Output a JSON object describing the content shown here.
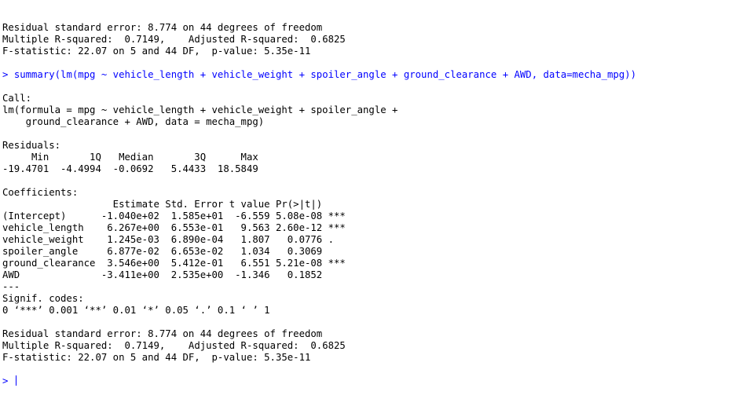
{
  "colors": {
    "command": "#0000ff",
    "output": "#000000",
    "background": "#ffffff"
  },
  "prev_output": [
    "Residual standard error: 8.774 on 44 degrees of freedom",
    "Multiple R-squared:  0.7149,\tAdjusted R-squared:  0.6825 ",
    "F-statistic: 22.07 on 5 and 44 DF,  p-value: 5.35e-11"
  ],
  "command": {
    "prompt": ">",
    "text": "summary(lm(mpg ~ vehicle_length + vehicle_weight + spoiler_angle + ground_clearance + AWD, data=mecha_mpg))"
  },
  "call": {
    "header": "Call:",
    "lines": [
      "lm(formula = mpg ~ vehicle_length + vehicle_weight + spoiler_angle + ",
      "    ground_clearance + AWD, data = mecha_mpg)"
    ]
  },
  "residuals": {
    "header": "Residuals:",
    "labels": "     Min       1Q   Median       3Q      Max ",
    "values": "-19.4701  -4.4994  -0.0692   5.4433  18.5849 "
  },
  "coefficients": {
    "header": "Coefficients:",
    "column_header": "                   Estimate Std. Error t value Pr(>|t|)    ",
    "rows": [
      "(Intercept)      -1.040e+02  1.585e+01  -6.559 5.08e-08 ***",
      "vehicle_length    6.267e+00  6.553e-01   9.563 2.60e-12 ***",
      "vehicle_weight    1.245e-03  6.890e-04   1.807   0.0776 .  ",
      "spoiler_angle     6.877e-02  6.653e-02   1.034   0.3069    ",
      "ground_clearance  3.546e+00  5.412e-01   6.551 5.21e-08 ***",
      "AWD              -3.411e+00  2.535e+00  -1.346   0.1852    "
    ],
    "separator": "---",
    "signif_header": "Signif. codes:  ",
    "signif_codes": "0 ‘***’ 0.001 ‘**’ 0.01 ‘*’ 0.05 ‘.’ 0.1 ‘ ’ 1"
  },
  "summary": [
    "Residual standard error: 8.774 on 44 degrees of freedom",
    "Multiple R-squared:  0.7149,\tAdjusted R-squared:  0.6825 ",
    "F-statistic: 22.07 on 5 and 44 DF,  p-value: 5.35e-11"
  ],
  "next_prompt": ">"
}
